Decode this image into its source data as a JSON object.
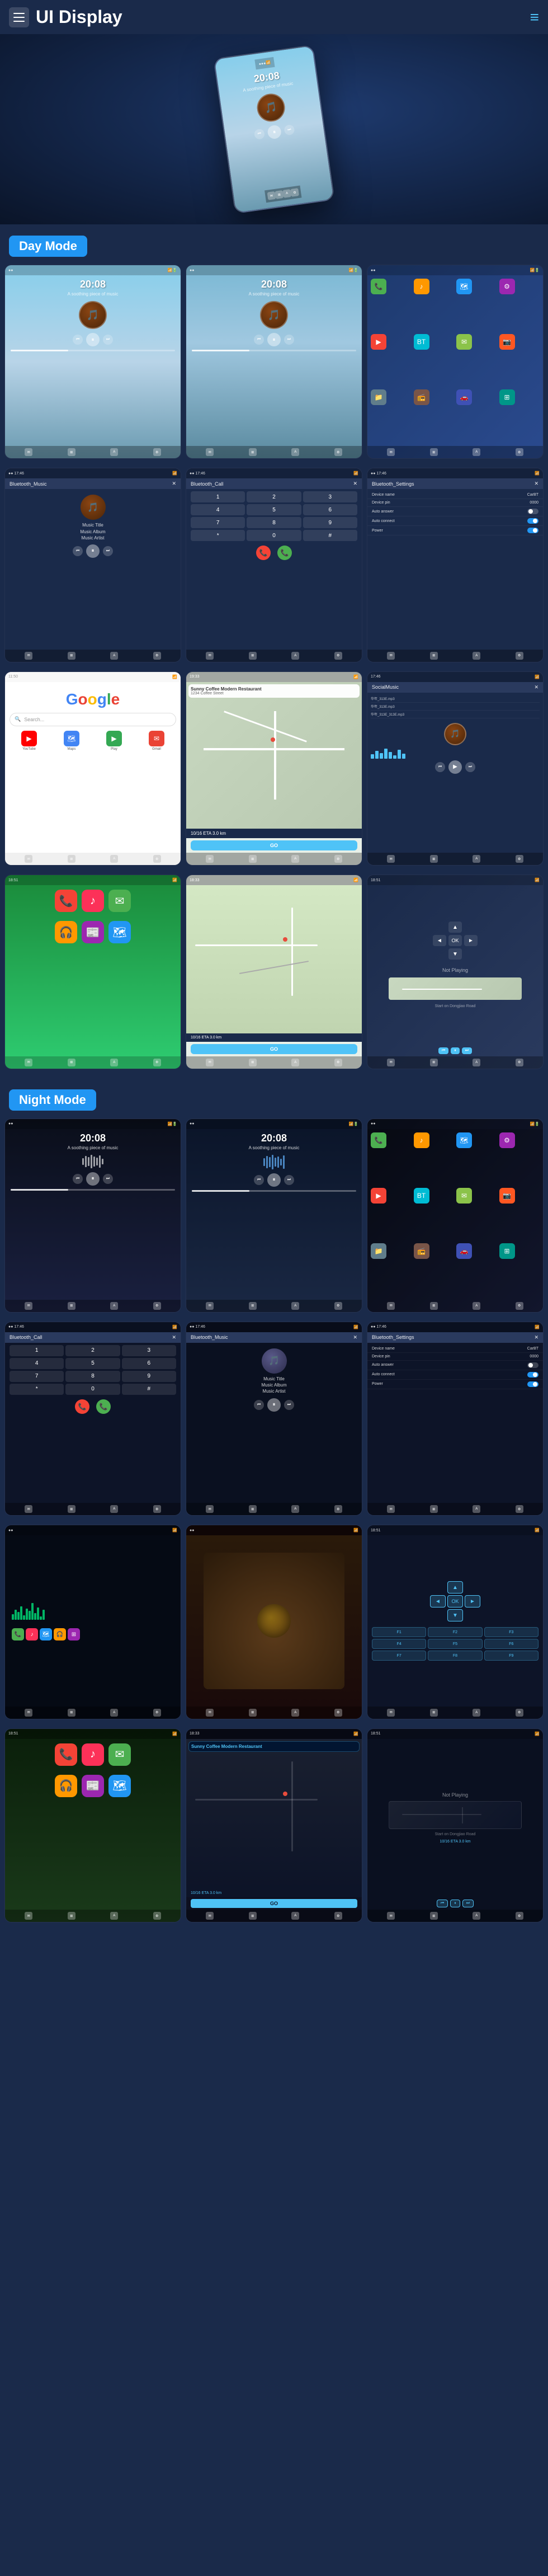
{
  "header": {
    "title": "UI Display",
    "menu_label": "menu",
    "nav_label": "navigation"
  },
  "sections": {
    "day_mode": "Day Mode",
    "night_mode": "Night Mode"
  },
  "screens": {
    "music": {
      "time": "20:08",
      "subtitle": "A soothing piece of music",
      "track_title": "Music Title",
      "track_album": "Music Album",
      "track_artist": "Music Artist"
    },
    "bluetooth_music": "Bluetooth_Music",
    "bluetooth_call": "Bluetooth_Call",
    "bluetooth_settings": "Bluetooth_Settings",
    "google": "Google",
    "navigation": {
      "restaurant": "Sunny Coffee Modern Restaurant",
      "address": "1234 Coffee Street",
      "eta_distance": "10/16 ETA  3.0 km",
      "go": "GO"
    },
    "not_playing": "Not Playing",
    "social_music": "SocialMusic"
  },
  "settings": {
    "device_name": {
      "label": "Device name",
      "value": "CarBT"
    },
    "device_pin": {
      "label": "Device pin",
      "value": "0000"
    },
    "auto_answer": {
      "label": "Auto answer"
    },
    "auto_connect": {
      "label": "Auto connect"
    },
    "power": {
      "label": "Power"
    }
  },
  "music_files": [
    "华年_313E.mp3",
    "华年_313E.mp3",
    "华年_313E_313E.mp3"
  ],
  "nav_direction": {
    "eta": "10/16 ETA  3.0 km",
    "instruction": "Start on Dongjiao Road",
    "not_playing": "Not Playing"
  },
  "icons": {
    "menu": "☰",
    "nav": "≡",
    "play": "▶",
    "pause": "⏸",
    "prev": "⏮",
    "next": "⏭",
    "search": "🔍",
    "back": "←",
    "close": "✕",
    "check": "✓",
    "bluetooth": "BT",
    "phone": "📞",
    "settings": "⚙",
    "music": "♪",
    "map": "🗺",
    "apps": "⊞"
  },
  "app_colors": {
    "phone": "#4CAF50",
    "messages": "#4CAF50",
    "maps": "#4285F4",
    "music": "#FC3158",
    "settings": "#8E8E93",
    "bt": "#2196F3",
    "youtube": "#FF0000",
    "podcast": "#9B59B6",
    "news": "#E74C3C",
    "camera": "#607D8B"
  },
  "numpad": [
    "1",
    "2",
    "3",
    "4",
    "5",
    "6",
    "7",
    "8",
    "9",
    "*",
    "0",
    "#"
  ]
}
